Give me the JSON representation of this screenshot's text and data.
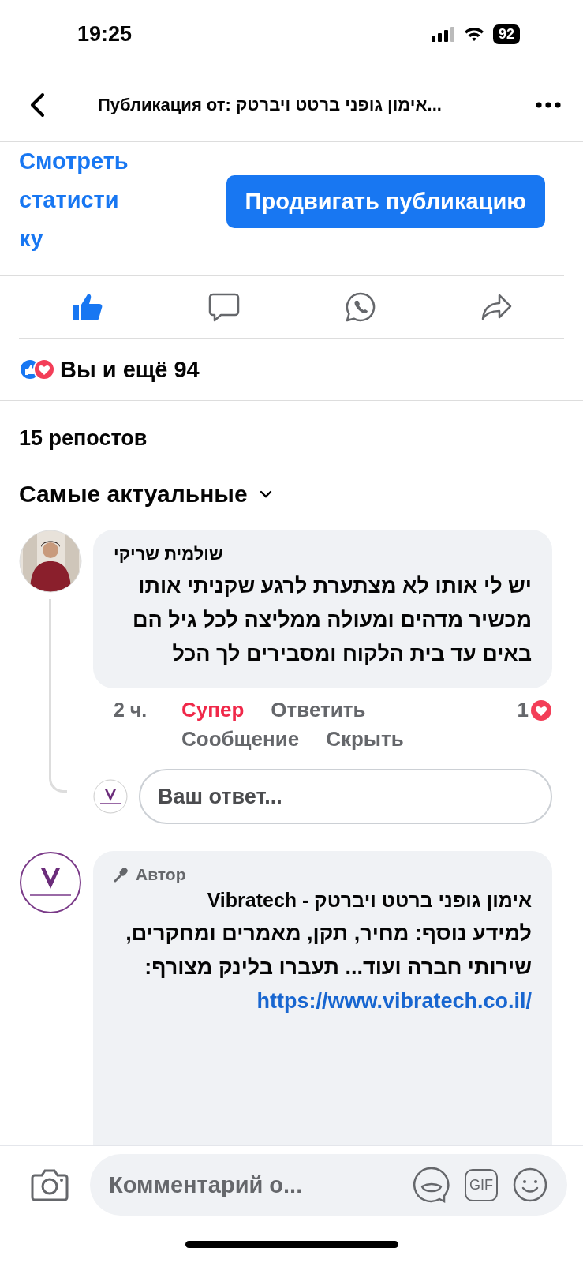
{
  "status_bar": {
    "time": "19:25",
    "battery": "92"
  },
  "nav": {
    "title": "Публикация от: אימון גופני ברטט ויברטק..."
  },
  "stats_link": "Смотреть статистику",
  "promote_button": "Продвигать публикацию",
  "actions": [
    {
      "kind": "like",
      "selected": true
    },
    {
      "kind": "comment",
      "selected": false
    },
    {
      "kind": "whatsapp",
      "selected": false
    },
    {
      "kind": "share",
      "selected": false
    }
  ],
  "reactions": {
    "text": "Вы и ещё 94"
  },
  "reposts": "15 репостов",
  "sort": {
    "label": "Самые актуальные"
  },
  "comments": [
    {
      "kind": "person",
      "author": "שולמית שריקי",
      "text": "יש לי אותו לא מצתערת לרגע שקניתי אותו מכשיר מדהים ומעולה ממליצה לכל גיל הם באים עד בית הלקוח ומסבירים לך הכל",
      "time": "2 ч.",
      "reaction": {
        "label": "Супер",
        "selected": true
      },
      "actions": [
        "Ответить",
        "Сообщение",
        "Скрыть"
      ],
      "likes": "1",
      "reply_placeholder": "Ваш ответ..."
    },
    {
      "kind": "page",
      "badge": "Автор",
      "author": "אימון גופני ברטט ויברטק - Vibratech",
      "text": "למידע נוסף: מחיר, תקן, מאמרים ומחקרים, שירותי חברה ועוד... תעברו בלינק מצורף:",
      "link": "https://www.vibratech.co.il/"
    }
  ],
  "composer": {
    "placeholder": "Комментарий о...",
    "gif": "GIF"
  }
}
